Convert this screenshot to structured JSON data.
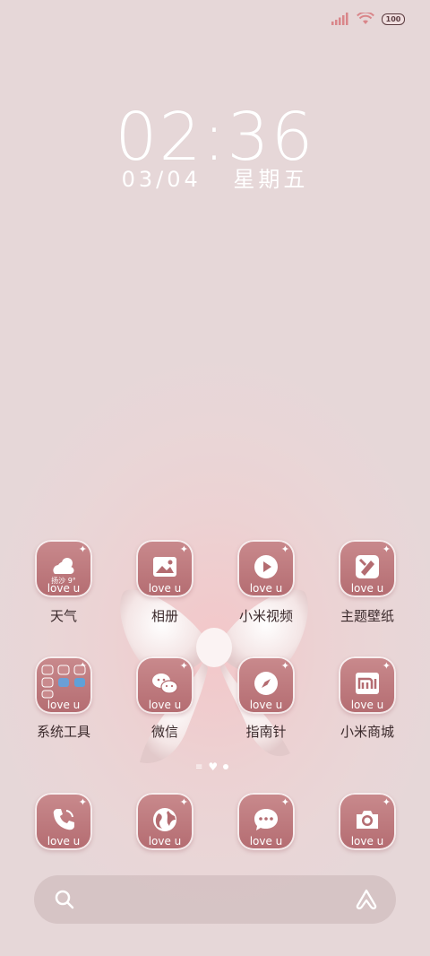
{
  "status_bar": {
    "battery": "100"
  },
  "lockscreen": {
    "time": "02:36",
    "date": "03/04",
    "weekday": "星期五"
  },
  "apps_row1": [
    {
      "name": "天气",
      "badge": "love u",
      "weather_text": "扬沙 9°"
    },
    {
      "name": "相册",
      "badge": "love u"
    },
    {
      "name": "小米视频",
      "badge": "love u"
    },
    {
      "name": "主题壁纸",
      "badge": "love u"
    }
  ],
  "apps_row2": [
    {
      "name": "系统工具",
      "badge": "love u"
    },
    {
      "name": "微信",
      "badge": "love u"
    },
    {
      "name": "指南针",
      "badge": "love u"
    },
    {
      "name": "小米商城",
      "badge": "love u"
    }
  ],
  "dock": [
    {
      "icon": "phone-icon",
      "badge": "love u"
    },
    {
      "icon": "browser-icon",
      "badge": "love u"
    },
    {
      "icon": "messages-icon",
      "badge": "love u"
    },
    {
      "icon": "camera-icon",
      "badge": "love u"
    }
  ],
  "colors": {
    "tile": "#b46c71",
    "signal": "#d9868a"
  }
}
